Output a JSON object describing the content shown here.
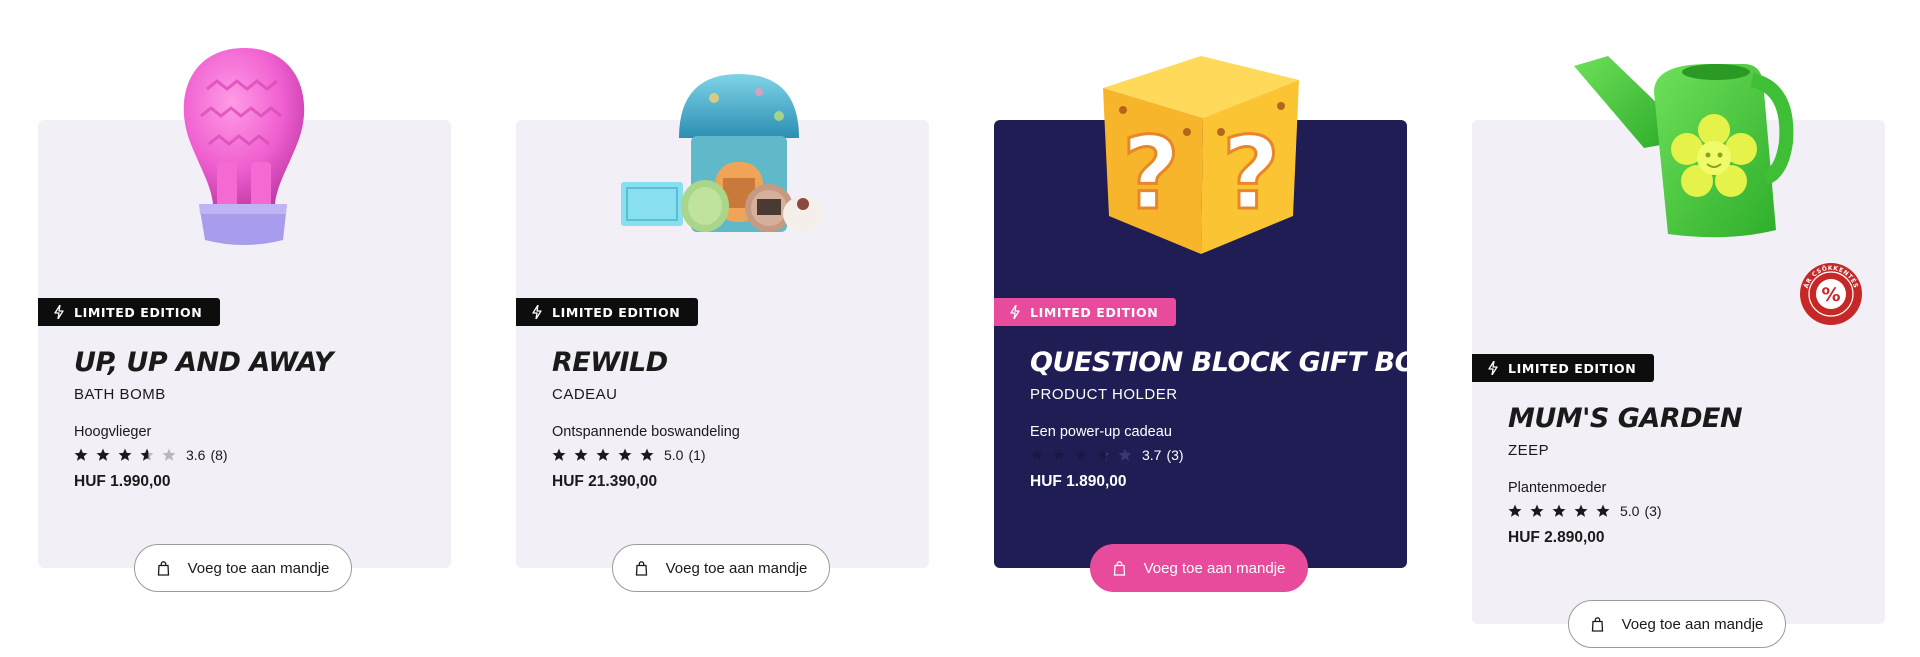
{
  "colors": {
    "card_background": "#f3eff6",
    "card_dark_background": "#201c54",
    "badge_background": "#0d0d0d",
    "accent_pink": "#e84a9c",
    "discount_red": "#c62828",
    "star_filled": "#1a1a1a",
    "star_empty": "#b8b8b8"
  },
  "products": [
    {
      "badge": "LIMITED EDITION",
      "title": "UP, UP AND AWAY",
      "category": "BATH BOMB",
      "subtitle": "Hoogvlieger",
      "rating": 3.6,
      "rating_display": "3.6",
      "reviews": "(8)",
      "price": "HUF 1.990,00",
      "cart_label": "Voeg toe aan mandje",
      "image": "hot-air-balloon-bath-bomb"
    },
    {
      "badge": "LIMITED EDITION",
      "title": "REWILD",
      "category": "CADEAU",
      "subtitle": "Ontspannende boswandeling",
      "rating": 5.0,
      "rating_display": "5.0",
      "reviews": "(1)",
      "price": "HUF 21.390,00",
      "cart_label": "Voeg toe aan mandje",
      "image": "mushroom-tin-gift-set"
    },
    {
      "badge": "LIMITED EDITION",
      "title": "QUESTION BLOCK GIFT BOX",
      "category": "PRODUCT HOLDER",
      "subtitle": "Een power-up cadeau",
      "rating": 3.7,
      "rating_display": "3.7",
      "reviews": "(3)",
      "price": "HUF 1.890,00",
      "cart_label": "Voeg toe aan mandje",
      "image": "question-block-box"
    },
    {
      "badge": "LIMITED EDITION",
      "title": "MUM'S GARDEN",
      "category": "ZEEP",
      "subtitle": "Plantenmoeder",
      "rating": 5.0,
      "rating_display": "5.0",
      "reviews": "(3)",
      "price": "HUF 2.890,00",
      "cart_label": "Voeg toe aan mandje",
      "image": "watering-can-soap",
      "discount_badge": {
        "symbol": "%",
        "text": "ÁR CSÖKKENTÉS"
      }
    }
  ]
}
